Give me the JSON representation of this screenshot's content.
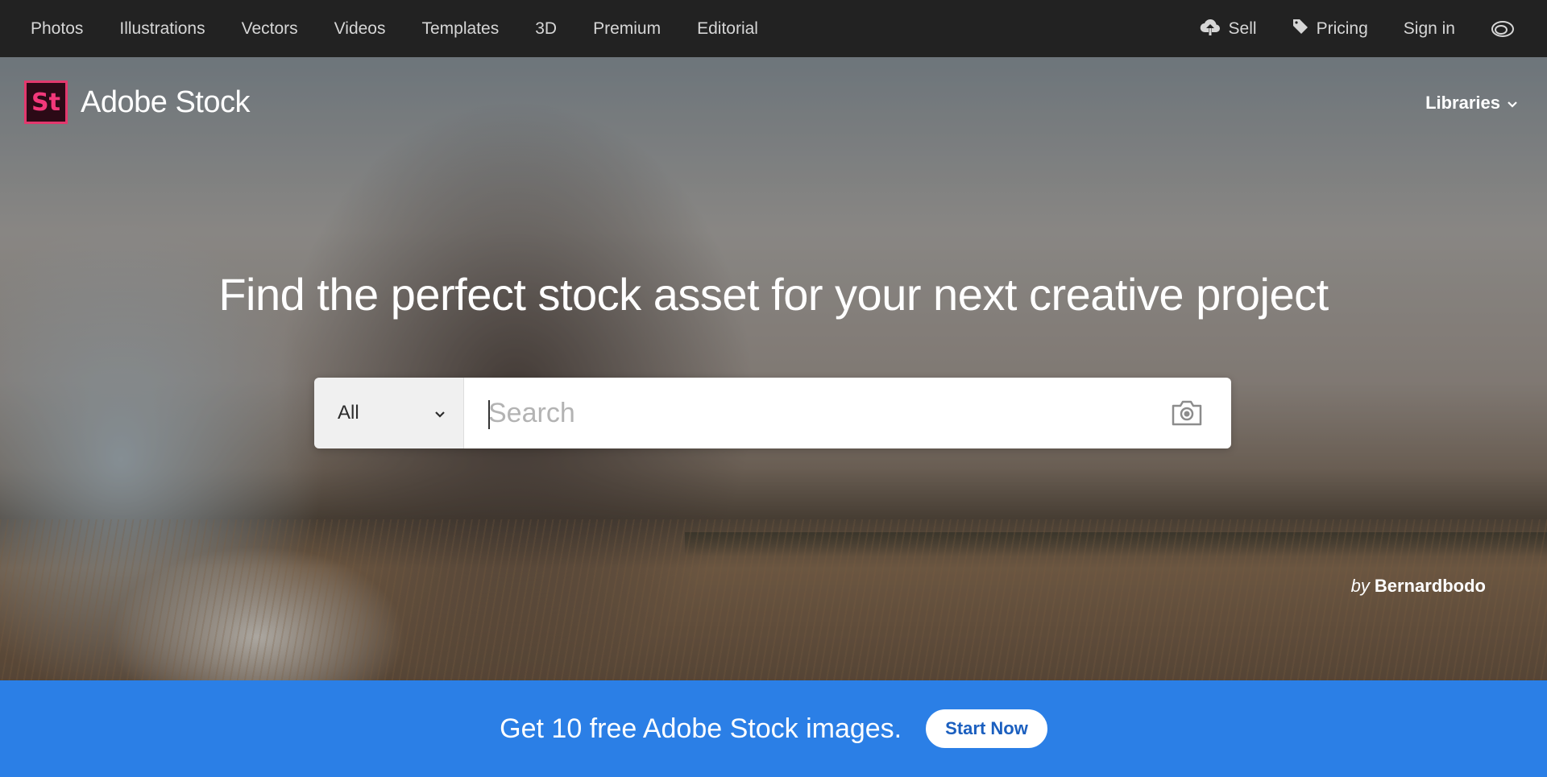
{
  "topnav": {
    "left_links": [
      "Photos",
      "Illustrations",
      "Vectors",
      "Videos",
      "Templates",
      "3D",
      "Premium",
      "Editorial"
    ],
    "sell_label": "Sell",
    "pricing_label": "Pricing",
    "signin_label": "Sign in",
    "icons": [
      "cloud-upload-icon",
      "tag-icon",
      "creative-cloud-icon"
    ]
  },
  "brand": {
    "logo_text": "St",
    "name": "Adobe Stock",
    "logo_color": "#e3386d"
  },
  "hero": {
    "libraries_label": "Libraries",
    "headline": "Find the perfect stock asset for your next creative project",
    "credit_by": "by",
    "credit_author": "Bernardbodo"
  },
  "search": {
    "category": "All",
    "placeholder": "Search",
    "icons": [
      "chevron-down-icon",
      "camera-icon"
    ]
  },
  "promo": {
    "text": "Get 10 free Adobe Stock images.",
    "button_label": "Start Now",
    "background": "#2b7fe6"
  }
}
